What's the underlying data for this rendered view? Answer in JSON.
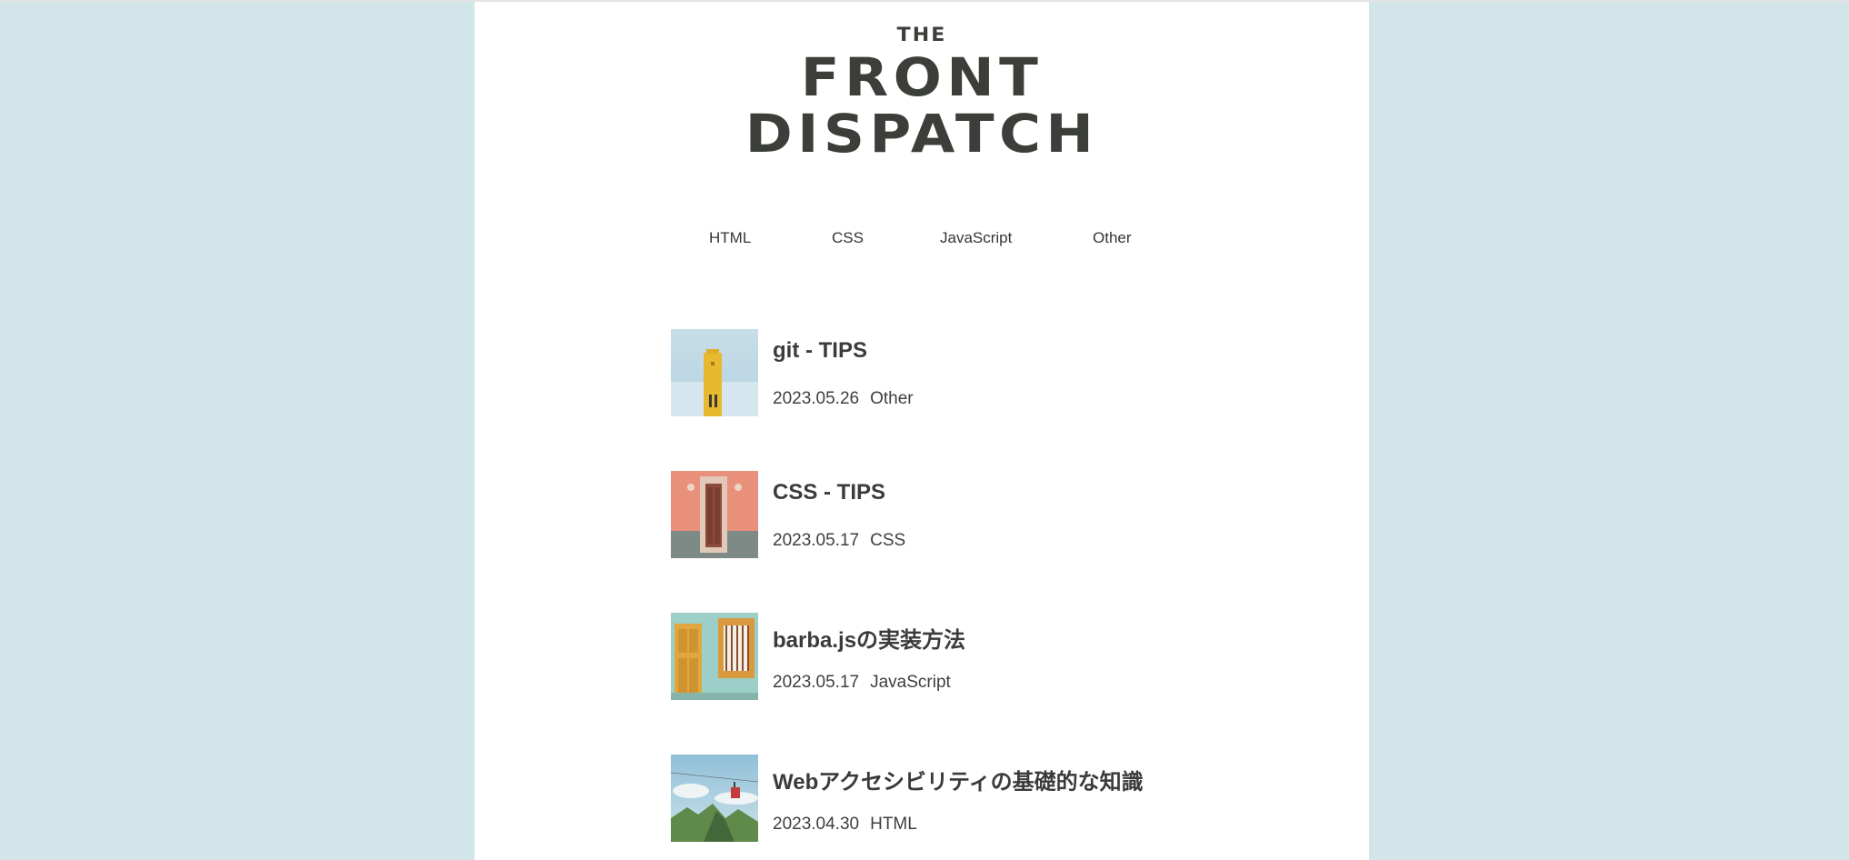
{
  "site": {
    "logo_the": "THE",
    "logo_line1": "FRONT",
    "logo_line2": "DISPATCH"
  },
  "nav": {
    "items": [
      {
        "label": "HTML"
      },
      {
        "label": "CSS"
      },
      {
        "label": "JavaScript"
      },
      {
        "label": "Other"
      }
    ]
  },
  "posts": [
    {
      "title": "git - TIPS",
      "date": "2023.05.26",
      "category": "Other"
    },
    {
      "title": "CSS - TIPS",
      "date": "2023.05.17",
      "category": "CSS"
    },
    {
      "title": "barba.jsの実装方法",
      "date": "2023.05.17",
      "category": "JavaScript"
    },
    {
      "title": "Webアクセシビリティの基礎的な知識",
      "date": "2023.04.30",
      "category": "HTML"
    }
  ],
  "colors": {
    "background": "#d2e6ea",
    "text": "#3a3c39"
  }
}
